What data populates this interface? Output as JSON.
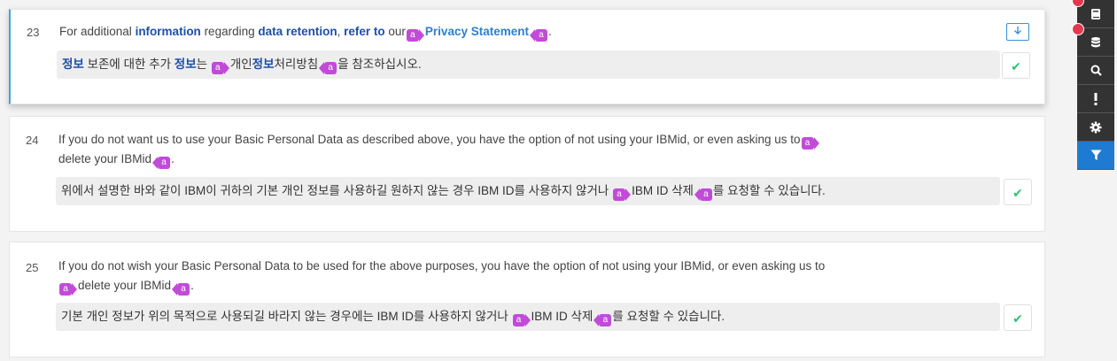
{
  "segments": [
    {
      "number": "23",
      "source": {
        "t1": "For additional ",
        "h1": "information",
        "t2": " regarding ",
        "h2": "data retention",
        "t3": ", ",
        "h3": "refer to",
        "t4": " our",
        "link": "Privacy Statement",
        "t5": "."
      },
      "target": {
        "h1": "정보",
        "t1": " 보존에 대한 추가 ",
        "h2": "정보",
        "t2": "는 ",
        "t3": "개인",
        "h3": "정보",
        "t4": "처리방침",
        "t5": "을 참조하십시오."
      },
      "download_icon": "download-icon",
      "status_icon": "check-icon"
    },
    {
      "number": "24",
      "source": {
        "line1": "If you do not want us to use your Basic Personal Data as described above, you have the option of not using your IBMid, or even asking us to",
        "line2": "delete your IBMid",
        "end": "."
      },
      "target": {
        "t1": "위에서 설명한 바와 같이 IBM이 귀하의 기본 개인 정보를 사용하길 원하지 않는 경우 IBM ID를 사용하지 않거나 ",
        "t2": "IBM ID 삭제",
        "t3": "를 요청할 수 있습니다."
      },
      "status_icon": "check-icon"
    },
    {
      "number": "25",
      "source": {
        "line1": "If you do not wish your Basic Personal Data to be used for the above purposes, you have the option of not using your IBMid, or even asking us to",
        "line2": "delete your IBMid",
        "end": "."
      },
      "target": {
        "t1": "기본 개인 정보가 위의 목적으로 사용되길 바라지 않는 경우에는 IBM ID를 사용하지 않거나 ",
        "t2": "IBM ID 삭제",
        "t3": "를 요청할 수 있습니다."
      },
      "status_icon": "check-icon"
    }
  ],
  "tag_label": "a",
  "toolbar": [
    {
      "icon": "book-icon",
      "notify": true
    },
    {
      "icon": "database-icon",
      "notify": true
    },
    {
      "icon": "search-icon",
      "notify": false
    },
    {
      "icon": "exclamation-icon",
      "notify": false
    },
    {
      "icon": "gear-icon",
      "notify": false
    },
    {
      "icon": "filter-icon",
      "notify": false,
      "active": true
    }
  ],
  "colors": {
    "accent": "#1f7ad1",
    "tag": "#c14bd8",
    "check": "#2ec275",
    "notify": "#e8364f",
    "highlight": "#1e4fa6"
  }
}
